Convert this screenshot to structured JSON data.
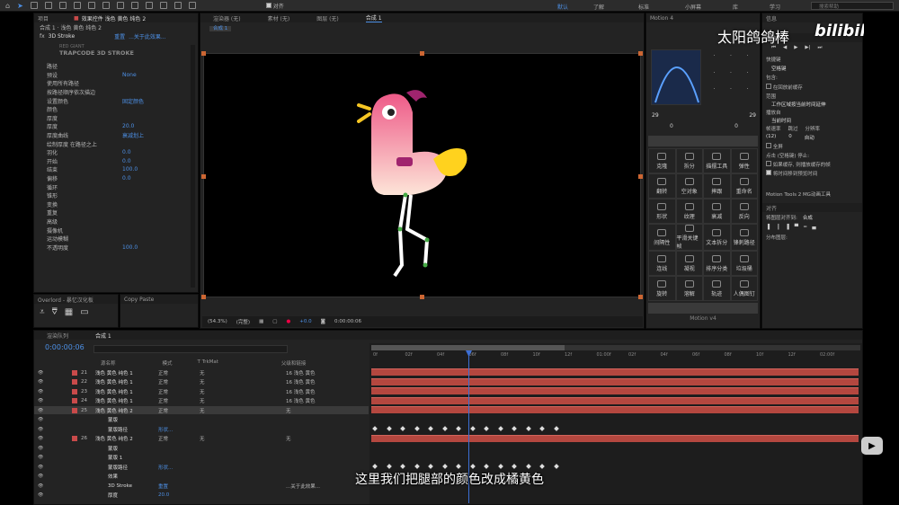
{
  "topbar": {
    "workspaces": [
      "默认",
      "了解",
      "标准",
      "小屏幕",
      "库",
      "学习"
    ],
    "align_label": "对齐",
    "search_placeholder": "搜索帮助"
  },
  "effects_panel": {
    "tab_project": "项目",
    "tab_effects": "效果控件 浅色 黄色 纯色 2",
    "comp_path": "合成 1 · 浅色 黄色 纯色 2",
    "effect_name": "3D Stroke",
    "reset": "重置",
    "about": "...关于此效果...",
    "plugin_brand": "RED GIANT",
    "plugin_title": "TRAPCODE 3D STROKE",
    "props": [
      {
        "label": "路径",
        "value": ""
      },
      {
        "label": "预设",
        "value": "None"
      },
      {
        "label": "使用所有路径",
        "value": ""
      },
      {
        "label": "按路径顺序依次描边",
        "value": ""
      },
      {
        "label": "设置颜色",
        "value": "固定颜色"
      },
      {
        "label": "颜色",
        "value": ""
      },
      {
        "label": "厚度",
        "value": ""
      },
      {
        "label": "厚度",
        "value": "20.0"
      },
      {
        "label": "厚度曲线",
        "value": "衰减划上"
      },
      {
        "label": "绘制厚度 在路径之上",
        "value": ""
      },
      {
        "label": "羽化",
        "value": "0.0"
      },
      {
        "label": "开始",
        "value": "0.0"
      },
      {
        "label": "结束",
        "value": "100.0"
      },
      {
        "label": "偏移",
        "value": "0.0"
      },
      {
        "label": "循环",
        "value": ""
      },
      {
        "label": "锥形",
        "value": ""
      },
      {
        "label": "变换",
        "value": ""
      },
      {
        "label": "重复",
        "value": ""
      },
      {
        "label": "高级",
        "value": ""
      },
      {
        "label": "摄像机",
        "value": ""
      },
      {
        "label": "运动模糊",
        "value": ""
      },
      {
        "label": "不透明度",
        "value": "100.0"
      }
    ]
  },
  "overlord": {
    "title": "Overlord - 暴忆汉化板",
    "copy_paste": "Copy Paste"
  },
  "viewer": {
    "tabs": [
      "渲染器 (无)",
      "素材 (无)",
      "图层 (无)",
      "合成 1"
    ],
    "comp_chip": "合成 1",
    "zoom": "(54.3%)",
    "quality": "(完整)",
    "exposure": "+0.0",
    "timecode": "0:00:00:06"
  },
  "motion": {
    "title": "Motion 4",
    "left_val": "29",
    "right_val": "29",
    "left_zero": "0",
    "right_zero": "0",
    "buttons": [
      "克隆",
      "拆分",
      "描摆工具",
      "弹性",
      "翻转",
      "空对象",
      "摔跟",
      "重命名",
      "形状",
      "纹理",
      "衰减",
      "反向",
      "间隔性",
      "平滑关键帧",
      "文本拆分",
      "锋刺路径",
      "连线",
      "凝视",
      "排序分类",
      "垃圾桶",
      "旋转",
      "溶解",
      "轨迹",
      "人偶图钉"
    ],
    "footer": "Motion v4"
  },
  "info_panel": {
    "title": "信息",
    "preview_label": "预览",
    "shortcut": "快捷键",
    "shortcut_value": "空格键",
    "include": "包含:",
    "cache_label": "在回放前缓存",
    "range_label": "范围",
    "range_value": "工作区域按当前时间延伸",
    "play_from": "播放自",
    "play_from_value": "当前时间",
    "fps_label": "帧速率",
    "skip_label": "跳过",
    "res_label": "分辨率",
    "fps_value": "(12)",
    "skip_value": "0",
    "res_value": "自动",
    "fullscreen": "全屏",
    "stop_label": "点击 (空格键) 停止:",
    "stop_opt1": "如果缓存, 则播放缓存的帧",
    "stop_opt2": "将时间移到预览时间",
    "motion_tools": "Motion Tools 2 MG动画工具",
    "align_title": "对齐",
    "align_to_label": "将图层对齐到:",
    "align_to_value": "合成",
    "distribute": "分布图层:"
  },
  "timeline": {
    "render_queue": "渲染队列",
    "comp_tab": "合成 1",
    "timecode": "0:00:00:06",
    "search_placeholder": "",
    "headers": [
      "源名称",
      "模式",
      "T TrkMat",
      "父级和链接"
    ],
    "rulers": [
      "0f",
      "02f",
      "04f",
      "06f",
      "08f",
      "10f",
      "12f",
      "01:00f",
      "02f",
      "04f",
      "06f",
      "08f",
      "10f",
      "12f",
      "02:00f"
    ],
    "rows": [
      {
        "num": "21",
        "name": "浅色 黄色 纯色 1",
        "mode": "正常",
        "trk": "无",
        "parent": "16 浅色 黄色"
      },
      {
        "num": "22",
        "name": "浅色 黄色 纯色 1",
        "mode": "正常",
        "trk": "无",
        "parent": "16 浅色 黄色"
      },
      {
        "num": "23",
        "name": "浅色 黄色 纯色 1",
        "mode": "正常",
        "trk": "无",
        "parent": "16 浅色 黄色"
      },
      {
        "num": "24",
        "name": "浅色 黄色 纯色 1",
        "mode": "正常",
        "trk": "无",
        "parent": "16 浅色 黄色"
      },
      {
        "num": "25",
        "name": "浅色 黄色 纯色 2",
        "mode": "正常",
        "trk": "无",
        "parent": "无"
      },
      {
        "num": "",
        "name": "蒙版",
        "mode": "",
        "trk": "",
        "parent": ""
      },
      {
        "num": "",
        "name": "蒙版路径",
        "mode": "形状...",
        "trk": "",
        "parent": ""
      },
      {
        "num": "26",
        "name": "浅色 黄色 纯色 2",
        "mode": "正常",
        "trk": "无",
        "parent": "无"
      },
      {
        "num": "",
        "name": "蒙版",
        "mode": "",
        "trk": "",
        "parent": ""
      },
      {
        "num": "",
        "name": "蒙版 1",
        "mode": "",
        "trk": "",
        "parent": ""
      },
      {
        "num": "",
        "name": "蒙版路径",
        "mode": "形状...",
        "trk": "",
        "parent": ""
      },
      {
        "num": "",
        "name": "效果",
        "mode": "",
        "trk": "",
        "parent": ""
      },
      {
        "num": "",
        "name": "3D Stroke",
        "mode": "重置",
        "trk": "",
        "parent": "...关于此效果..."
      },
      {
        "num": "",
        "name": "厚度",
        "mode": "20.0",
        "trk": "",
        "parent": ""
      }
    ]
  },
  "watermark": {
    "author": "太阳鸽鸽棒",
    "brand": "bilibili"
  },
  "subtitle": "这里我们把腿部的颜色改成橘黄色",
  "colors": {
    "accent": "#4d90e6",
    "label_red": "#c94a4a",
    "bar": "#b4473f",
    "cursor": "#3d6fd6",
    "bird_pink": "#ee5a88",
    "wing": "#ffd21e",
    "beak": "#f6c623",
    "crest": "#a0246e"
  }
}
